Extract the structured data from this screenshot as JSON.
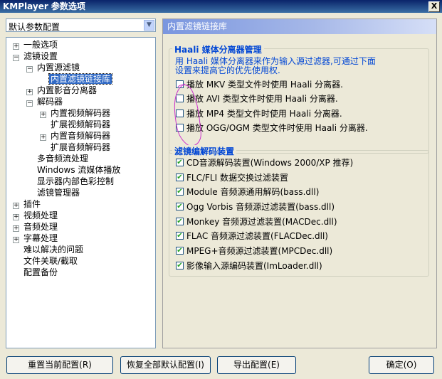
{
  "window": {
    "title": "KMPlayer 参数选项",
    "close_label": "X"
  },
  "preset": {
    "selected": "默认参数配置"
  },
  "tree": {
    "general": "一般选项",
    "filter_settings": "滤镜设置",
    "builtin_source": "内置源滤镜",
    "builtin_splitter": "内置滤镜链接库",
    "builtin_media_splitter": "内置影音分离器",
    "decoders": "解码器",
    "builtin_video_dec": "内置视频解码器",
    "ext_video_dec": "扩展视频解码器",
    "builtin_audio_dec": "内置音频解码器",
    "ext_audio_dec": "扩展音频解码器",
    "multi_audio": "多音频流处理",
    "windows_media": "Windows 流媒体播放",
    "display_color": "显示器内部色彩控制",
    "filter_manager": "滤镜管理器",
    "plugins": "插件",
    "video": "视频处理",
    "audio": "音频处理",
    "subtitles": "字幕处理",
    "troubleshoot": "难以解决的问题",
    "file_assoc": "文件关联/截取",
    "backup": "配置备份"
  },
  "panel": {
    "title": "内置滤镜链接库",
    "haali": {
      "title": "Haali 媒体分离器管理",
      "desc_line1": "用 Haali 媒体分离器来作为输入源过滤器,可通过下面",
      "desc_line2": "设置来提高它的优先使用权.",
      "items": [
        "播放 MKV 类型文件时使用 Haali 分离器.",
        "播放 AVI 类型文件时使用 Haali 分离器.",
        "播放 MP4 类型文件时使用 Haali 分离器.",
        "播放 OGG/OGM 类型文件时使用 Haali 分离器."
      ]
    },
    "decoders": {
      "title": "滤镜编解码装置",
      "items": [
        "CD音源解码装置(Windows 2000/XP 推荐)",
        "FLC/FLI 数据交换过滤装置",
        "Module 音频源通用解码(bass.dll)",
        "Ogg Vorbis 音频源过滤装置(bass.dll)",
        "Monkey 音频源过滤装置(MACDec.dll)",
        "FLAC 音频源过滤装置(FLACDec.dll)",
        "MPEG+音频源过滤装置(MPCDec.dll)",
        "影像输入源编码装置(ImLoader.dll)"
      ]
    }
  },
  "buttons": {
    "reset_current": "重置当前配置(R)",
    "restore_defaults": "恢复全部默认配置(I)",
    "export": "导出配置(E)",
    "ok": "确定(O)"
  },
  "colors": {
    "accent": "#0046d5",
    "selection": "#316ac5",
    "check": "#21a121",
    "annotation": "#cc33cc"
  }
}
